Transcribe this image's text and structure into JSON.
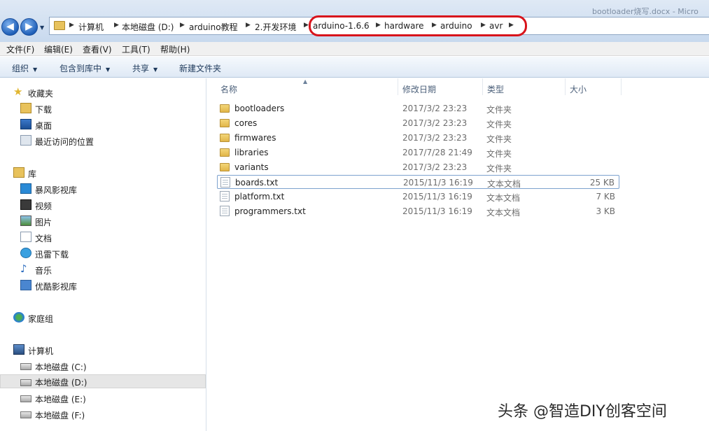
{
  "window": {
    "title": "bootloader烧写.docx - Micro"
  },
  "address": {
    "crumbs": [
      "计算机",
      "本地磁盘 (D:)",
      "arduino教程",
      "2.开发环境",
      "arduino-1.6.6",
      "hardware",
      "arduino",
      "avr"
    ]
  },
  "menu": [
    "文件(F)",
    "编辑(E)",
    "查看(V)",
    "工具(T)",
    "帮助(H)"
  ],
  "toolbar": {
    "organize": "组织",
    "include": "包含到库中",
    "share": "共享",
    "new_folder": "新建文件夹"
  },
  "nav": {
    "favorites": {
      "label": "收藏夹",
      "items": [
        "下载",
        "桌面",
        "最近访问的位置"
      ]
    },
    "libraries": {
      "label": "库",
      "items": [
        "暴风影视库",
        "视频",
        "图片",
        "文档",
        "迅雷下载",
        "音乐",
        "优酷影视库"
      ]
    },
    "homegroup": {
      "label": "家庭组"
    },
    "computer": {
      "label": "计算机",
      "items": [
        "本地磁盘 (C:)",
        "本地磁盘 (D:)",
        "本地磁盘 (E:)",
        "本地磁盘 (F:)"
      ]
    }
  },
  "columns": {
    "name": "名称",
    "date": "修改日期",
    "type": "类型",
    "size": "大小"
  },
  "files": [
    {
      "name": "bootloaders",
      "date": "2017/3/2 23:23",
      "type": "文件夹",
      "size": "",
      "kind": "folder"
    },
    {
      "name": "cores",
      "date": "2017/3/2 23:23",
      "type": "文件夹",
      "size": "",
      "kind": "folder"
    },
    {
      "name": "firmwares",
      "date": "2017/3/2 23:23",
      "type": "文件夹",
      "size": "",
      "kind": "folder"
    },
    {
      "name": "libraries",
      "date": "2017/7/28 21:49",
      "type": "文件夹",
      "size": "",
      "kind": "folder"
    },
    {
      "name": "variants",
      "date": "2017/3/2 23:23",
      "type": "文件夹",
      "size": "",
      "kind": "folder"
    },
    {
      "name": "boards.txt",
      "date": "2015/11/3 16:19",
      "type": "文本文档",
      "size": "25 KB",
      "kind": "doc"
    },
    {
      "name": "platform.txt",
      "date": "2015/11/3 16:19",
      "type": "文本文档",
      "size": "7 KB",
      "kind": "doc"
    },
    {
      "name": "programmers.txt",
      "date": "2015/11/3 16:19",
      "type": "文本文档",
      "size": "3 KB",
      "kind": "doc"
    }
  ],
  "watermark": "头条 @智造DIY创客空间",
  "colors": {
    "highlight_oval": "#d8141c",
    "selection_border": "#7da2ce"
  }
}
